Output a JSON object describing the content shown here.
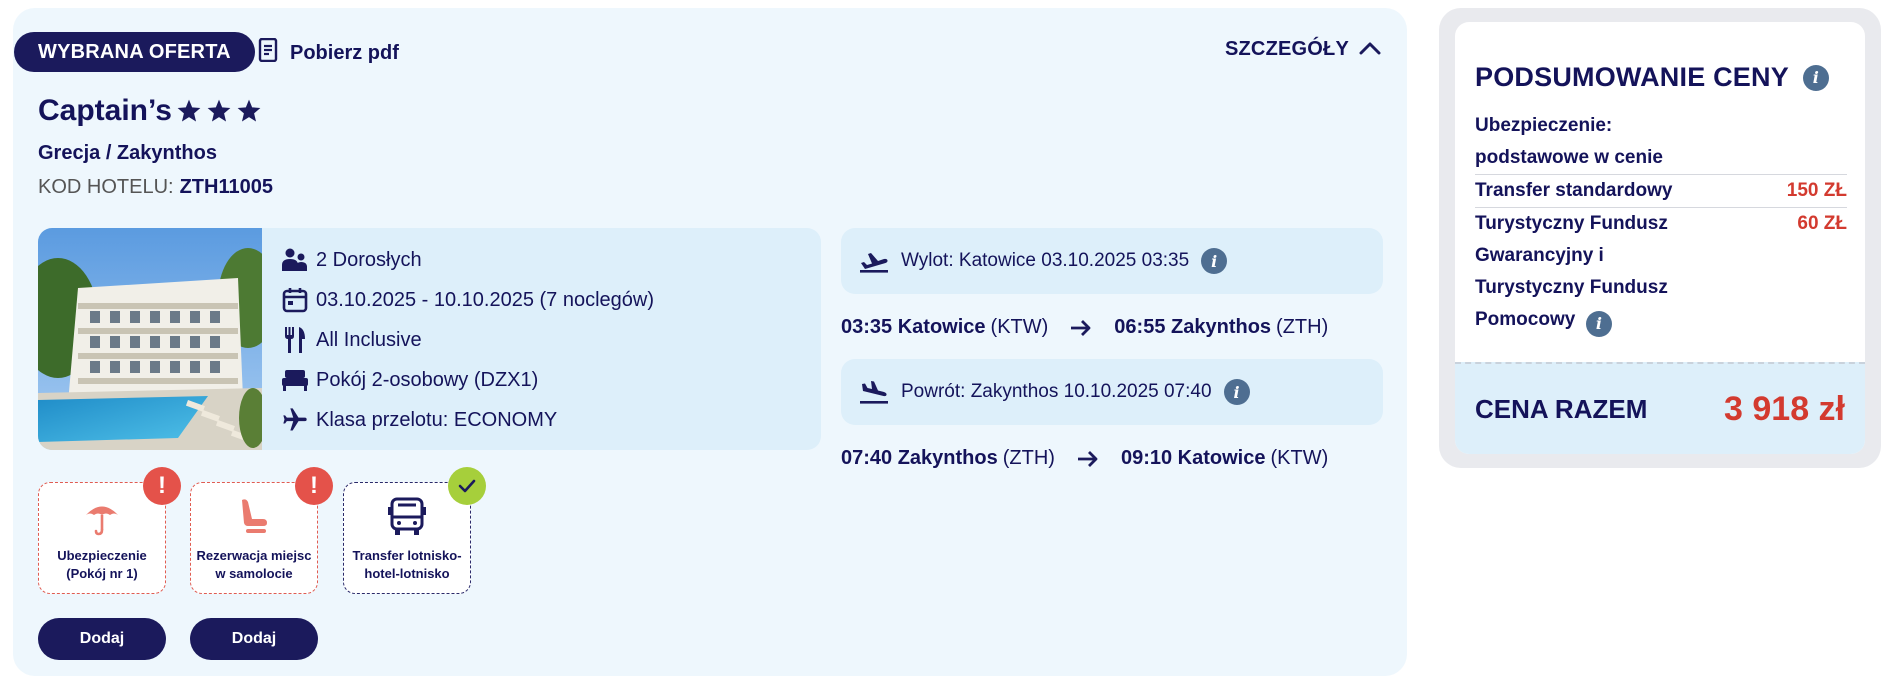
{
  "offer": {
    "badge": "WYBRANA OFERTA",
    "pdf_label": "Pobierz pdf",
    "details_label": "SZCZEGÓŁY",
    "hotel_name": "Captain’s",
    "stars": 3,
    "location": "Grecja / Zakynthos",
    "hotel_code_label": "KOD HOTELU:",
    "hotel_code": "ZTH11005",
    "info": {
      "guests": "2 Dorosłych",
      "dates": "03.10.2025 - 10.10.2025 (7 noclegów)",
      "board": "All Inclusive",
      "room": "Pokój 2-osobowy (DZX1)",
      "flight_class": "Klasa przelotu: ECONOMY"
    },
    "departure": {
      "label": "Wylot: Katowice 03.10.2025 03:35",
      "dep_time": "03:35",
      "dep_city": "Katowice",
      "dep_code": "(KTW)",
      "arr_time": "06:55",
      "arr_city": "Zakynthos",
      "arr_code": "(ZTH)"
    },
    "return": {
      "label": "Powrót: Zakynthos 10.10.2025 07:40",
      "dep_time": "07:40",
      "dep_city": "Zakynthos",
      "dep_code": "(ZTH)",
      "arr_time": "09:10",
      "arr_city": "Katowice",
      "arr_code": "(KTW)"
    },
    "addons": [
      {
        "line1": "Ubezpieczenie",
        "line2": "(Pokój nr 1)",
        "status": "warning",
        "button": "Dodaj"
      },
      {
        "line1": "Rezerwacja miejsc",
        "line2": "w samolocie",
        "status": "warning",
        "button": "Dodaj"
      },
      {
        "line1": "Transfer lotnisko-",
        "line2": "hotel-lotnisko",
        "status": "ok"
      }
    ]
  },
  "summary": {
    "title": "PODSUMOWANIE CENY",
    "insurance_line1": "Ubezpieczenie:",
    "insurance_line2": "podstawowe w cenie",
    "transfer_label": "Transfer standardowy",
    "transfer_price": "150 ZŁ",
    "fund_label1": "Turystyczny Fundusz",
    "fund_label2": "Gwarancyjny i",
    "fund_label3": "Turystyczny Fundusz",
    "fund_label4": "Pomocowy",
    "fund_price": "60 ZŁ",
    "total_label": "CENA RAZEM",
    "total_value": "3 918 zł"
  },
  "colors": {
    "navy": "#1b1a5c",
    "card_bg": "#eef7fd",
    "info_bg": "#ddeffa",
    "price_red": "#d33a2f",
    "warning_red": "#e4524a",
    "ok_green": "#a6cf3b",
    "info_icon": "#4e6e91"
  }
}
